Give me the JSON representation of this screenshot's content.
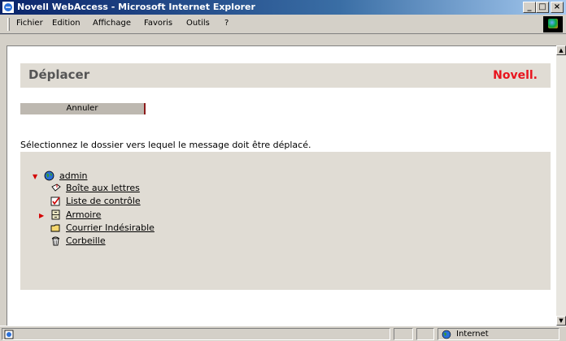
{
  "window": {
    "title": "Novell WebAccess - Microsoft Internet Explorer",
    "min_label": "_",
    "max_label": "□",
    "close_label": "×"
  },
  "menu": {
    "items": [
      "Fichier",
      "Edition",
      "Affichage",
      "Favoris",
      "Outils",
      "?"
    ]
  },
  "page": {
    "title": "Déplacer",
    "brand": "Novell.",
    "cancel_label": "Annuler",
    "instruction": "Sélectionnez le dossier vers lequel le message doit être déplacé."
  },
  "folders": {
    "root": {
      "label": "admin",
      "icon": "globe-icon",
      "expanded": true
    },
    "items": [
      {
        "label": "Boîte aux lettres",
        "icon": "mailbox-icon"
      },
      {
        "label": "Liste de contrôle",
        "icon": "checklist-icon"
      },
      {
        "label": "Armoire",
        "icon": "cabinet-icon",
        "collapsed": true
      },
      {
        "label": "Courrier Indésirable",
        "icon": "folder-icon"
      },
      {
        "label": "Corbeille",
        "icon": "trash-icon"
      }
    ]
  },
  "status": {
    "zone": "Internet"
  },
  "colors": {
    "brand_red": "#e8141e",
    "panel_bg": "#e0dcd4",
    "titlebar": "#0a246a"
  }
}
